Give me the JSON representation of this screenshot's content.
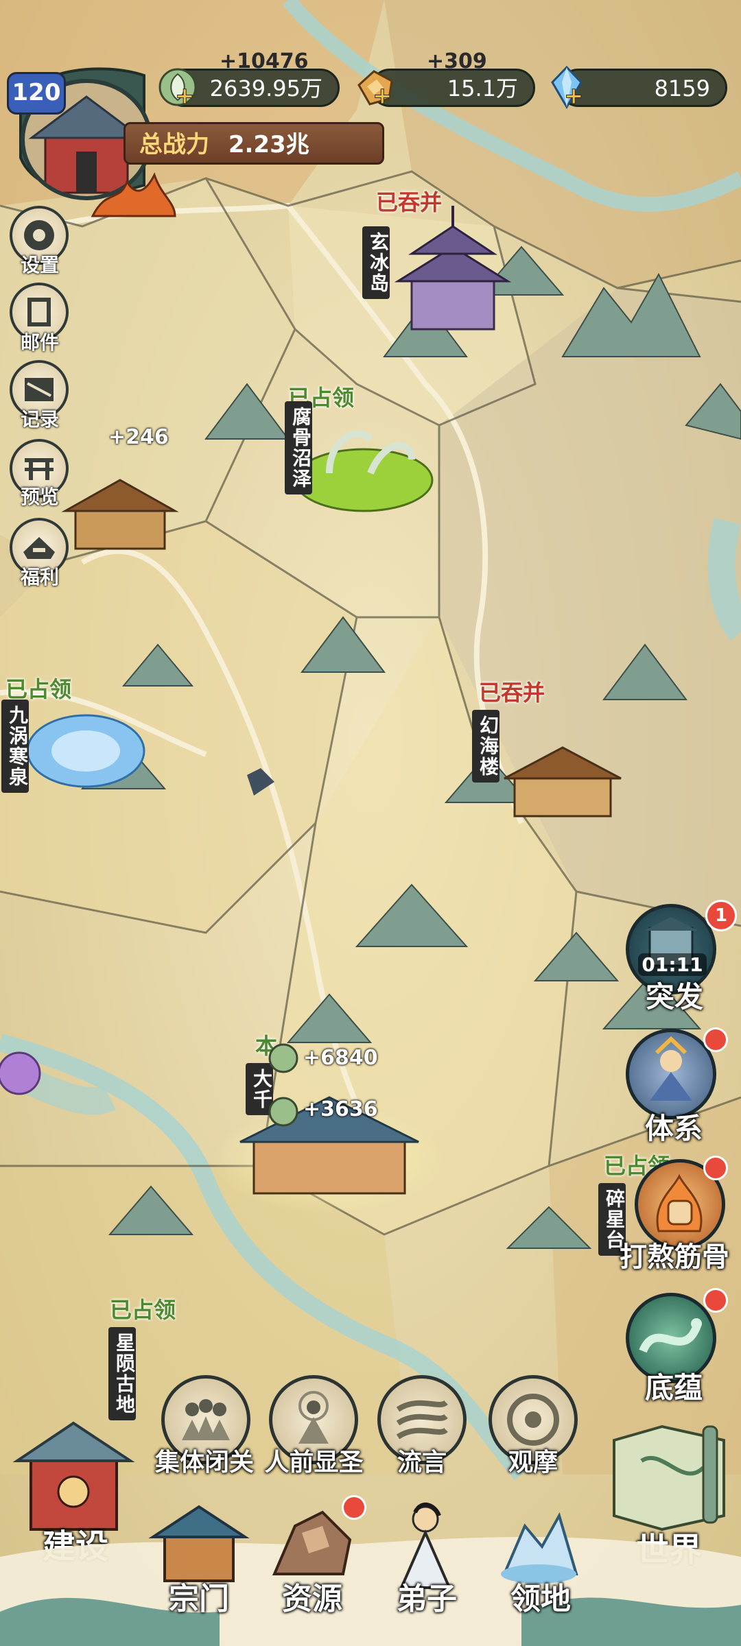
{
  "player": {
    "level": "120",
    "power_label": "总战力",
    "power_value": "2.23兆"
  },
  "resources": [
    {
      "icon": "leaf-coin-icon",
      "delta": "+10476",
      "value": "2639.95万"
    },
    {
      "icon": "ore-icon",
      "delta": "+309",
      "value": "15.1万"
    },
    {
      "icon": "crystal-icon",
      "delta": "",
      "value": "8159"
    }
  ],
  "side_menu": [
    {
      "icon": "gear-icon",
      "label": "设置"
    },
    {
      "icon": "mail-icon",
      "label": "邮件"
    },
    {
      "icon": "scroll-icon",
      "label": "记录"
    },
    {
      "icon": "gate-icon",
      "label": "预览"
    },
    {
      "icon": "gift-icon",
      "label": "福利"
    }
  ],
  "locations": [
    {
      "name": "玄冰岛",
      "status": "已吞并"
    },
    {
      "name": "腐骨沼泽",
      "status": "已占领"
    },
    {
      "name": "九涡寒泉",
      "status": "已占领"
    },
    {
      "name": "幻海楼",
      "status": "已吞并"
    },
    {
      "name": "星陨古地",
      "status": "已占领"
    },
    {
      "name": "碎星台",
      "status": "已占领"
    },
    {
      "name": "大千",
      "status": "本"
    }
  ],
  "gains": {
    "left_map": "+246",
    "home_1": "+6840",
    "home_2": "+3636"
  },
  "right_menu": {
    "breakthrough": {
      "label": "突发",
      "timer": "01:11",
      "badge": "1"
    },
    "system": {
      "label": "体系"
    },
    "training": {
      "label": "打熬筋骨"
    },
    "heritage": {
      "label": "底蕴"
    },
    "world": {
      "label": "世界"
    }
  },
  "actions": [
    {
      "icon": "meditate-icon",
      "label": "集体闭关"
    },
    {
      "icon": "saint-icon",
      "label": "人前显圣"
    },
    {
      "icon": "wind-icon",
      "label": "流言"
    },
    {
      "icon": "eye-swirl-icon",
      "label": "观摩"
    }
  ],
  "build": {
    "label": "建设"
  },
  "nav": [
    {
      "icon": "sect-icon",
      "label": "宗门"
    },
    {
      "icon": "resource-icon",
      "label": "资源"
    },
    {
      "icon": "disciple-icon",
      "label": "弟子"
    },
    {
      "icon": "territory-icon",
      "label": "领地"
    }
  ],
  "colors": {
    "map_base": "#e9d9a8",
    "river": "#a9d2cf",
    "mountain": "#7f9e8f",
    "occupied_green": "#4c8a2f",
    "annexed_red": "#c23a2b"
  }
}
